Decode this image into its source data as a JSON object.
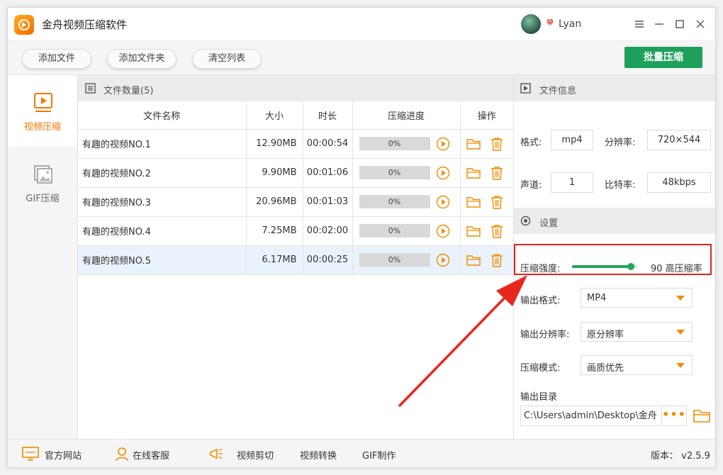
{
  "app": {
    "title": "金舟视频压缩软件",
    "username": "Lyan"
  },
  "toolbar": {
    "add_file": "添加文件",
    "add_folder": "添加文件夹",
    "clear_list": "清空列表",
    "batch_compress": "批量压缩"
  },
  "sidebar": {
    "items": [
      {
        "label": "视频压缩"
      },
      {
        "label": "GIF压缩"
      }
    ]
  },
  "files": {
    "count_label": "文件数量(5)",
    "columns": [
      "文件名称",
      "大小",
      "时长",
      "压缩进度",
      "操作"
    ],
    "rows": [
      {
        "name": "有趣的视频NO.1",
        "size": "12.90MB",
        "duration": "00:00:54",
        "progress": "0%"
      },
      {
        "name": "有趣的视频NO.2",
        "size": "9.90MB",
        "duration": "00:01:06",
        "progress": "0%"
      },
      {
        "name": "有趣的视频NO.3",
        "size": "20.96MB",
        "duration": "00:01:03",
        "progress": "0%"
      },
      {
        "name": "有趣的视频NO.4",
        "size": "7.25MB",
        "duration": "00:02:00",
        "progress": "0%"
      },
      {
        "name": "有趣的视频NO.5",
        "size": "6.17MB",
        "duration": "00:00:25",
        "progress": "0%"
      }
    ]
  },
  "info": {
    "title": "文件信息",
    "format_label": "格式:",
    "format": "mp4",
    "resolution_label": "分辨率:",
    "resolution": "720×544",
    "channel_label": "声道:",
    "channel": "1",
    "bitrate_label": "比特率:",
    "bitrate": "48kbps"
  },
  "settings": {
    "title": "设置",
    "strength_label": "压缩强度:",
    "strength_value": "90 高压缩率",
    "strength": 90,
    "output_format_label": "输出格式:",
    "output_format": "MP4",
    "output_resolution_label": "输出分辨率:",
    "output_resolution": "原分辨率",
    "mode_label": "压缩模式:",
    "mode": "画质优先",
    "output_dir_label": "输出目录",
    "output_dir": "C:\\Users\\admin\\Desktop\\金舟",
    "more": "•••"
  },
  "footer": {
    "links": [
      "官方网站",
      "在线客服",
      "视频剪切",
      "视频转换",
      "GIF制作"
    ],
    "version": "版本： v2.5.9"
  },
  "colors": {
    "accent_orange": "#f07800",
    "accent_green": "#1ea05a",
    "annotation_red": "#e0241b"
  }
}
